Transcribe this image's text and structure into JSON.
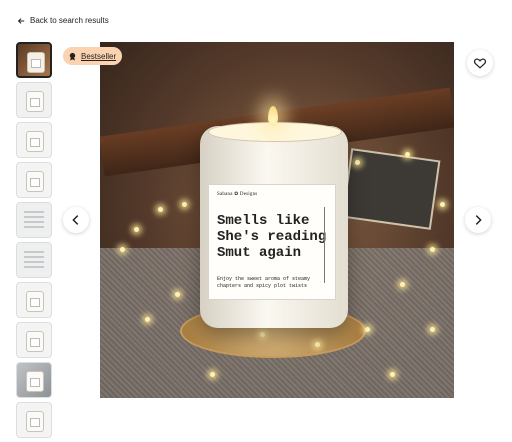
{
  "back_link": {
    "label": "Back to search results",
    "icon": "arrow-left-icon"
  },
  "badge": {
    "label": "Bestseller",
    "icon": "award-ribbon-icon",
    "color": "#fcd3b1"
  },
  "candle_label": {
    "brand": "Sabana ✿ Designs",
    "slogan_lines": [
      "Smells like",
      "She's reading",
      "Smut again"
    ],
    "description": "Enjoy the sweet aroma of steamy chapters and spicy plot twists"
  },
  "thumbnails": [
    {
      "type": "photo",
      "selected": true
    },
    {
      "type": "light",
      "selected": false
    },
    {
      "type": "white",
      "selected": false
    },
    {
      "type": "white",
      "selected": false
    },
    {
      "type": "doc",
      "selected": false
    },
    {
      "type": "doc",
      "selected": false
    },
    {
      "type": "white",
      "selected": false
    },
    {
      "type": "white",
      "selected": false
    },
    {
      "type": "grey",
      "selected": false
    },
    {
      "type": "white",
      "selected": false
    }
  ],
  "controls": {
    "favorite_icon": "heart-icon",
    "previous_icon": "chevron-left-icon",
    "next_icon": "chevron-right-icon"
  }
}
